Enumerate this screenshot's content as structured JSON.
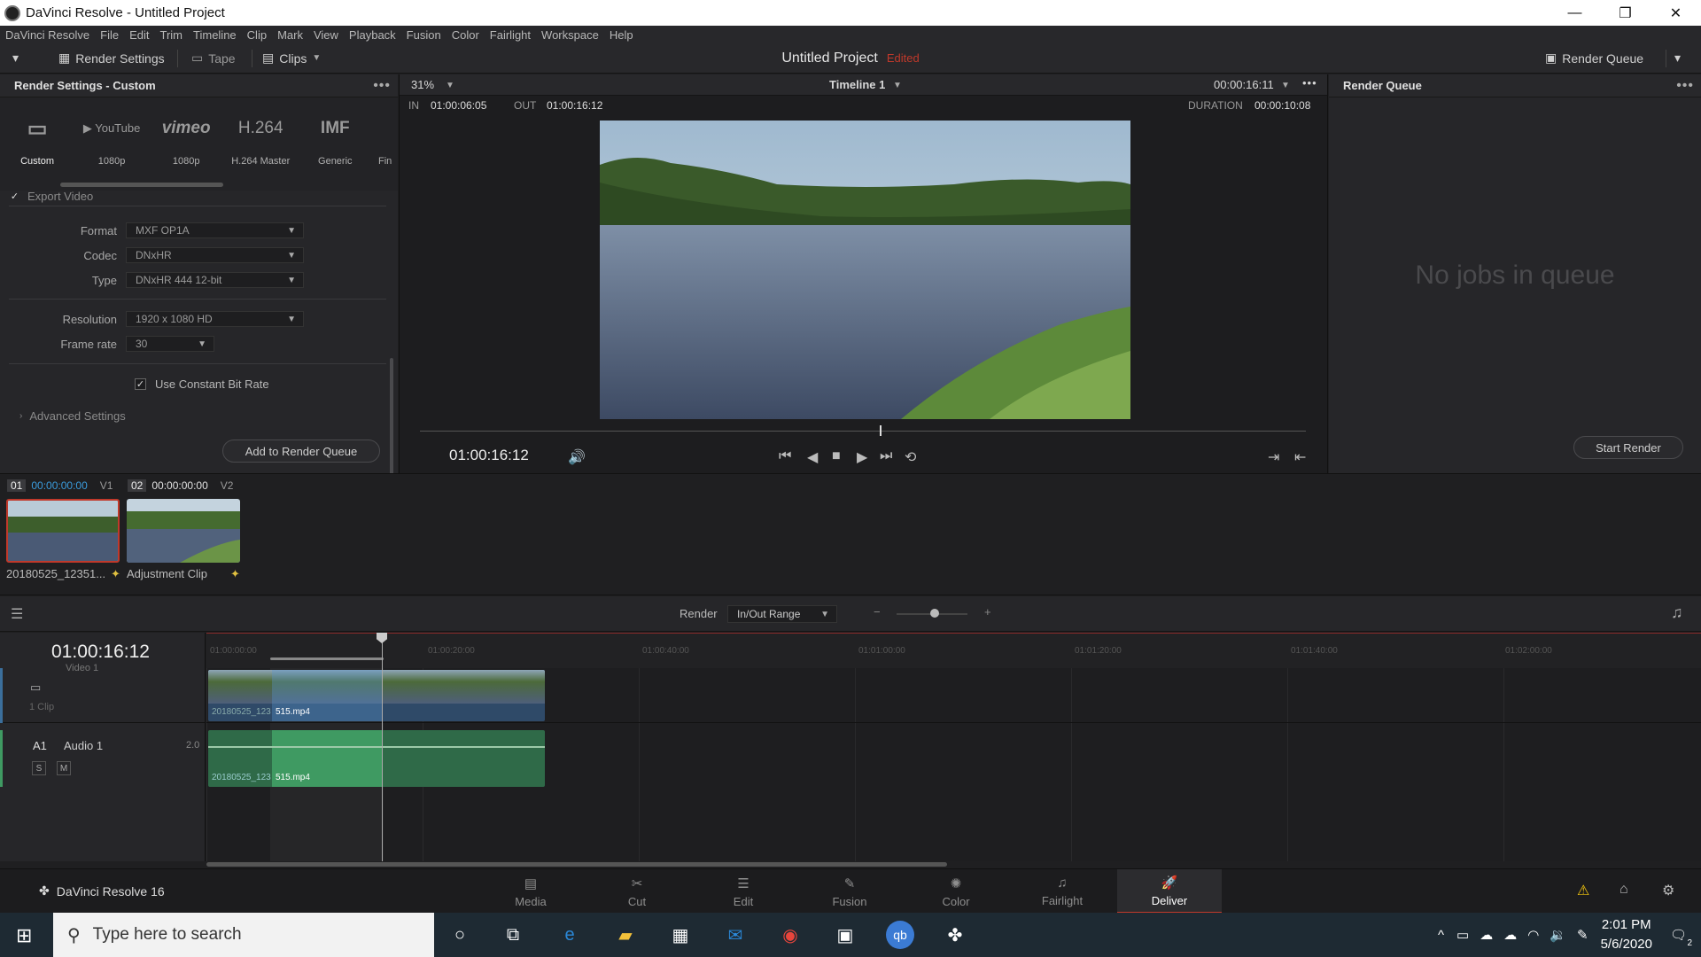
{
  "window": {
    "title": "DaVinci Resolve - Untitled Project",
    "controls": {
      "minimize": "—",
      "maximize": "❐",
      "close": "✕"
    }
  },
  "menu": [
    "DaVinci Resolve",
    "File",
    "Edit",
    "Trim",
    "Timeline",
    "Clip",
    "Mark",
    "View",
    "Playback",
    "Fusion",
    "Color",
    "Fairlight",
    "Workspace",
    "Help"
  ],
  "toolbar": {
    "render_settings": "Render Settings",
    "tape": "Tape",
    "clips": "Clips",
    "project_title": "Untitled Project",
    "edited": "Edited",
    "render_queue": "Render Queue"
  },
  "render_settings": {
    "header": "Render Settings - Custom",
    "presets": [
      {
        "icon": "▭",
        "label": "Custom"
      },
      {
        "icon": "▶ YouTube",
        "label": "1080p"
      },
      {
        "icon": "vimeo",
        "label": "1080p"
      },
      {
        "icon": "H.264",
        "label": "H.264 Master"
      },
      {
        "icon": "IMF",
        "label": "Generic"
      },
      {
        "icon": "",
        "label": "Fin"
      }
    ],
    "export_video": "Export Video",
    "format_label": "Format",
    "format_value": "MXF OP1A",
    "codec_label": "Codec",
    "codec_value": "DNxHR",
    "type_label": "Type",
    "type_value": "DNxHR 444 12-bit",
    "resolution_label": "Resolution",
    "resolution_value": "1920 x 1080 HD",
    "framerate_label": "Frame rate",
    "framerate_value": "30",
    "constant_bitrate": "Use Constant Bit Rate",
    "advanced": "Advanced Settings",
    "add_button": "Add to Render Queue"
  },
  "viewer": {
    "zoom": "31%",
    "timeline": "Timeline 1",
    "timecode": "00:00:16:11",
    "in_label": "IN",
    "in_value": "01:00:06:05",
    "out_label": "OUT",
    "out_value": "01:00:16:12",
    "duration_label": "DURATION",
    "duration_value": "00:00:10:08",
    "current_tc": "01:00:16:12"
  },
  "render_queue": {
    "header": "Render Queue",
    "empty": "No jobs in queue",
    "start": "Start Render"
  },
  "clips": [
    {
      "num": "01",
      "tc": "00:00:00:00",
      "track": "V1",
      "name": "20180525_12351...",
      "tc_color": "#3a9bdc"
    },
    {
      "num": "02",
      "tc": "00:00:00:00",
      "track": "V2",
      "name": "Adjustment Clip",
      "tc_color": "#e0e0e0"
    }
  ],
  "timeline": {
    "render_label": "Render",
    "render_value": "In/Out Range",
    "timecode": "01:00:16:12",
    "ruler": [
      "01:00:00:00",
      "01:00:20:00",
      "01:00:40:00",
      "01:01:00:00",
      "01:01:20:00",
      "01:01:40:00",
      "01:02:00:00"
    ],
    "video_track_name": "Video 1",
    "video_clip_count": "1 Clip",
    "audio_track_id": "A1",
    "audio_track_name": "Audio 1",
    "audio_channels": "2.0",
    "solo": "S",
    "mute": "M",
    "clip_name_prefix": "20180525_123",
    "clip_name_suffix": "515.mp4"
  },
  "pages": [
    {
      "name": "Media",
      "icon": "▤"
    },
    {
      "name": "Cut",
      "icon": "✂"
    },
    {
      "name": "Edit",
      "icon": "☰"
    },
    {
      "name": "Fusion",
      "icon": "✎"
    },
    {
      "name": "Color",
      "icon": "✺"
    },
    {
      "name": "Fairlight",
      "icon": "♫"
    },
    {
      "name": "Deliver",
      "icon": "🚀"
    }
  ],
  "app_name": "DaVinci Resolve 16",
  "taskbar": {
    "search_placeholder": "Type here to search",
    "time": "2:01 PM",
    "date": "5/6/2020",
    "notifications": "2"
  },
  "colors": {
    "accent_red": "#c0392b",
    "video_clip": "#3b6f9c",
    "audio_clip": "#3f9a62",
    "timecode_blue": "#3a9bdc"
  }
}
